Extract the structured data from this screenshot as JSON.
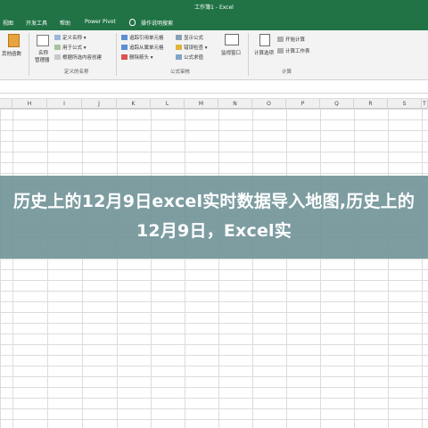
{
  "window": {
    "title": "工作簿1 - Excel"
  },
  "tabs": [
    "视图",
    "开发工具",
    "帮助",
    "Power Pivot"
  ],
  "tell_me": "操作说明搜索",
  "ribbon": {
    "groups": [
      {
        "name": "definednames_first",
        "large_buttons": [
          {
            "label": "其他函数"
          }
        ]
      },
      {
        "name": "定义的名称",
        "large_buttons": [
          {
            "label_line1": "名称",
            "label_line2": "管理器"
          }
        ],
        "small_buttons": [
          "定义名称",
          "用于公式",
          "根据所选内容创建"
        ]
      },
      {
        "name": "公式审核",
        "small_buttons": [
          "追踪引用单元格",
          "追踪从属单元格",
          "删除箭头",
          "显示公式",
          "错误检查",
          "公式求值"
        ],
        "large_buttons": [
          {
            "label": "监视窗口"
          }
        ]
      },
      {
        "name": "计算",
        "large_buttons": [
          {
            "label": "计算选项"
          }
        ],
        "small_buttons": [
          "开始计算",
          "计算工作表"
        ]
      }
    ]
  },
  "columns": [
    "H",
    "I",
    "J",
    "K",
    "L",
    "M",
    "N",
    "O",
    "P",
    "Q",
    "R",
    "S",
    "T"
  ],
  "headline": "历史上的12月9日excel实时数据导入地图,历史上的12月9日，Excel实",
  "colors": {
    "excel_green": "#217346",
    "overlay": "#6f9297"
  }
}
